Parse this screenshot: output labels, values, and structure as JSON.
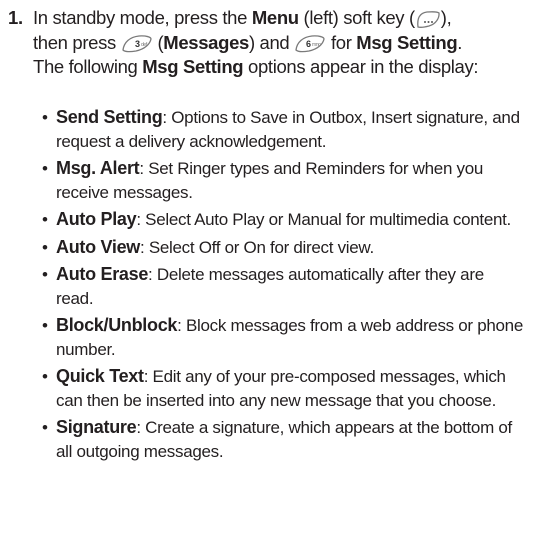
{
  "step": {
    "number": "1.",
    "seg1": "In standby mode, press the ",
    "menu": "Menu",
    "seg2": " (left) soft key (",
    "seg3": "),",
    "seg4": "then press ",
    "seg5": " (",
    "messages": "Messages",
    "seg6": ") and ",
    "seg7": " for ",
    "msg_setting": "Msg Setting",
    "seg8": ".",
    "seg9": "The following ",
    "msg_setting2": "Msg Setting",
    "seg10": " options appear in the display:",
    "key3_label": "3",
    "key6_label": "6"
  },
  "options": [
    {
      "term": "Send Setting",
      "desc": ": Options to Save in Outbox, Insert signature, and request a delivery acknowledgement."
    },
    {
      "term": "Msg. Alert",
      "desc": ": Set Ringer types and Reminders for when you receive messages."
    },
    {
      "term": "Auto Play",
      "desc": ": Select Auto Play or Manual for multimedia content."
    },
    {
      "term": "Auto View",
      "desc": ": Select Off or On for direct view."
    },
    {
      "term": "Auto Erase",
      "desc": ": Delete messages automatically after they are read."
    },
    {
      "term": "Block/Unblock",
      "desc": ": Block messages from a web address or phone number."
    },
    {
      "term": "Quick Text",
      "desc": ": Edit any of your pre-composed messages, which can then be inserted into any new message that you choose."
    },
    {
      "term": "Signature",
      "desc": ": Create a signature, which appears at the bottom of all outgoing messages."
    }
  ],
  "bullet_char": "•",
  "icons": {
    "soft_key": "left-soft-key-icon",
    "key3": "key-3-icon",
    "key6": "key-6-icon"
  },
  "colors": {
    "text": "#231f20",
    "key_outline": "#7a7a7a"
  }
}
